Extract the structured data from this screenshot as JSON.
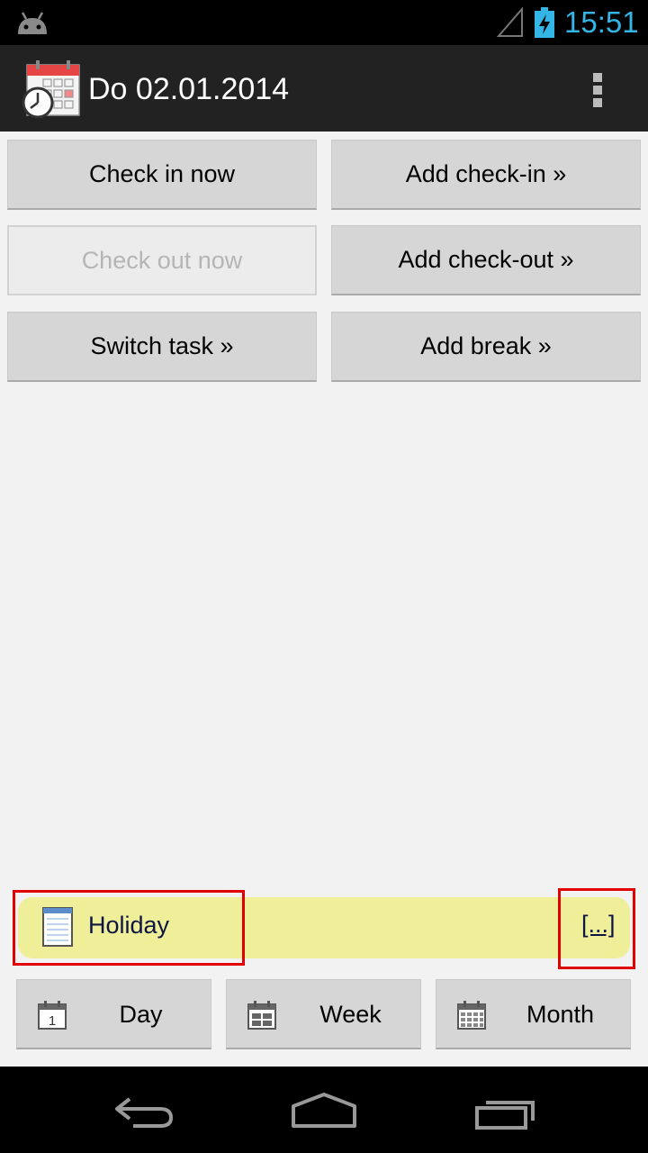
{
  "status_bar": {
    "time": "15:51",
    "icons": [
      "android-notification-icon",
      "signal-icon",
      "battery-charging-icon"
    ],
    "accent_color": "#33b5e5"
  },
  "action_bar": {
    "title": "Do 02.01.2014",
    "icons": [
      "calendar-clock-app-icon",
      "overflow-menu-icon"
    ]
  },
  "actions": {
    "check_in_now": "Check in now",
    "add_check_in": "Add check-in »",
    "check_out_now": "Check out now",
    "add_check_out": "Add check-out »",
    "switch_task": "Switch task »",
    "add_break": "Add break »"
  },
  "note": {
    "label": "Holiday",
    "more": "[...]",
    "icon": "notepad-icon",
    "background_color": "#efef99"
  },
  "views": {
    "day": "Day",
    "week": "Week",
    "month": "Month"
  },
  "navigation": {
    "icons": [
      "back-icon",
      "home-icon",
      "recent-apps-icon"
    ]
  }
}
